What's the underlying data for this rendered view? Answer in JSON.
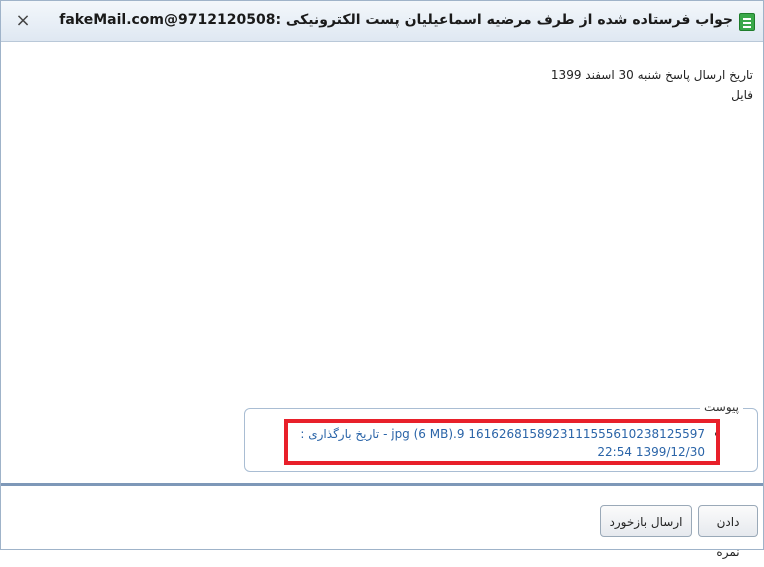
{
  "window": {
    "title": "جواب فرستاده شده از طرف مرضیه اسماعیلیان پست الکترونیکی :fakeMail.com@9712120508",
    "close_glyph": "×"
  },
  "message": {
    "send_date": "تاریخ ارسال پاسخ شنبه 30 اسفند 1399",
    "body": "فایل"
  },
  "attachments": {
    "legend": "پیوست",
    "items": [
      {
        "text": "1616268158923111555610238125597 9.jpg (6 MB) - تاریخ بارگذاری : 1399/12/30 22:54"
      }
    ]
  },
  "buttons": {
    "grade": "دادن نمره",
    "send_feedback": "ارسال بازخورد"
  }
}
